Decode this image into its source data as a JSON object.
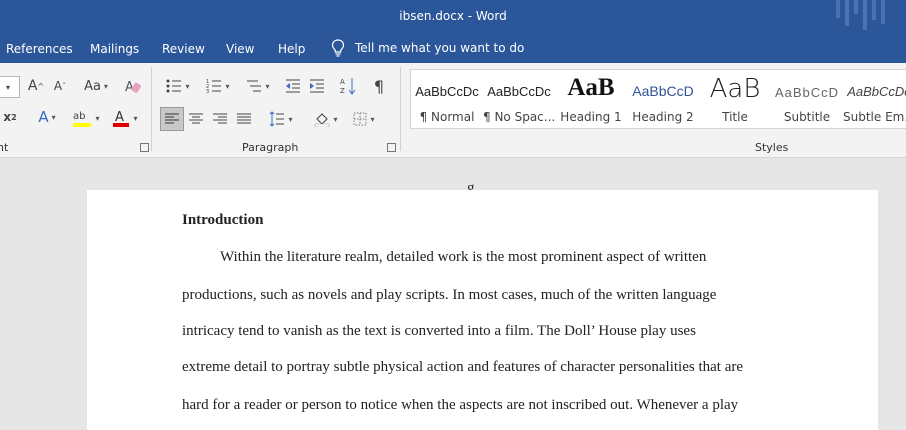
{
  "window": {
    "title": "ibsen.docx  -  Word"
  },
  "menu": {
    "tabs": [
      "References",
      "Mailings",
      "Review",
      "View",
      "Help"
    ],
    "tell_me": "Tell me what you want to do"
  },
  "ribbon": {
    "font_group_label": "nt",
    "paragraph_group_label": "Paragraph",
    "styles_group_label": "Styles",
    "styles": [
      {
        "preview": "AaBbCcDc",
        "name": "¶ Normal"
      },
      {
        "preview": "AaBbCcDc",
        "name": "¶ No Spac..."
      },
      {
        "preview": "AaB",
        "name": "Heading 1"
      },
      {
        "preview": "AaBbCcD",
        "name": "Heading 2"
      },
      {
        "preview": "AaB",
        "name": "Title"
      },
      {
        "preview": "AaBbCcD",
        "name": "Subtitle"
      },
      {
        "preview": "AaBbCcDc",
        "name": "Subtle Em..."
      }
    ],
    "colors": {
      "highlight": "#ffff00",
      "font_color": "#e00000"
    }
  },
  "document": {
    "heading": "Introduction",
    "lines": [
      "Within the literature realm, detailed work is the most prominent aspect of written",
      "productions, such as novels and play scripts. In most cases, much of the written language",
      "intricacy tend to vanish as the text is converted into a film. The Doll’ House play uses",
      "extreme detail to portray subtle physical action and features of character personalities that are",
      "hard for a reader or person to notice when the aspects are not inscribed out. Whenever a play"
    ]
  },
  "colors": {
    "accent": "#2b579a",
    "ribbon_bg": "#f3f3f3",
    "canvas": "#e6e6e6"
  }
}
